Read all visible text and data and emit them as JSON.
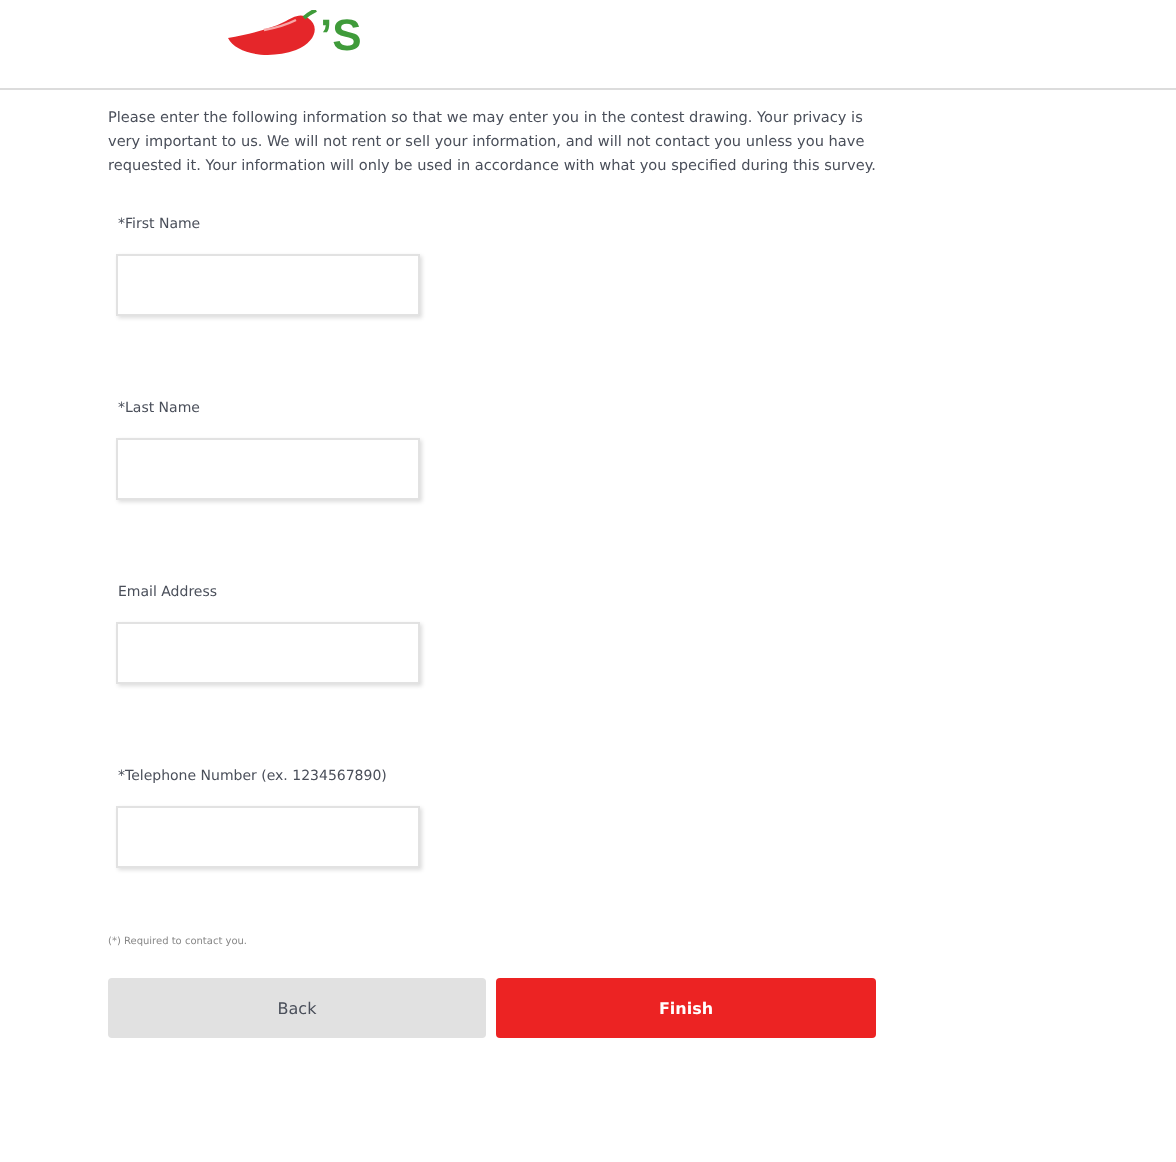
{
  "header": {
    "logo_text": "’S"
  },
  "intro": "Please enter the following information so that we may enter you in the contest drawing. Your privacy is very important to us. We will not rent or sell your information, and will not contact you unless you have requested it. Your information will only be used in accordance with what you specified during this survey.",
  "fields": [
    {
      "label": "*First Name"
    },
    {
      "label": "*Last Name"
    },
    {
      "label": "Email Address"
    },
    {
      "label": "*Telephone Number (ex. 1234567890)"
    }
  ],
  "footnote": "(*) Required to contact you.",
  "buttons": [
    {
      "label": "Back",
      "kind": "secondary"
    },
    {
      "label": "Finish",
      "kind": "primary"
    }
  ]
}
